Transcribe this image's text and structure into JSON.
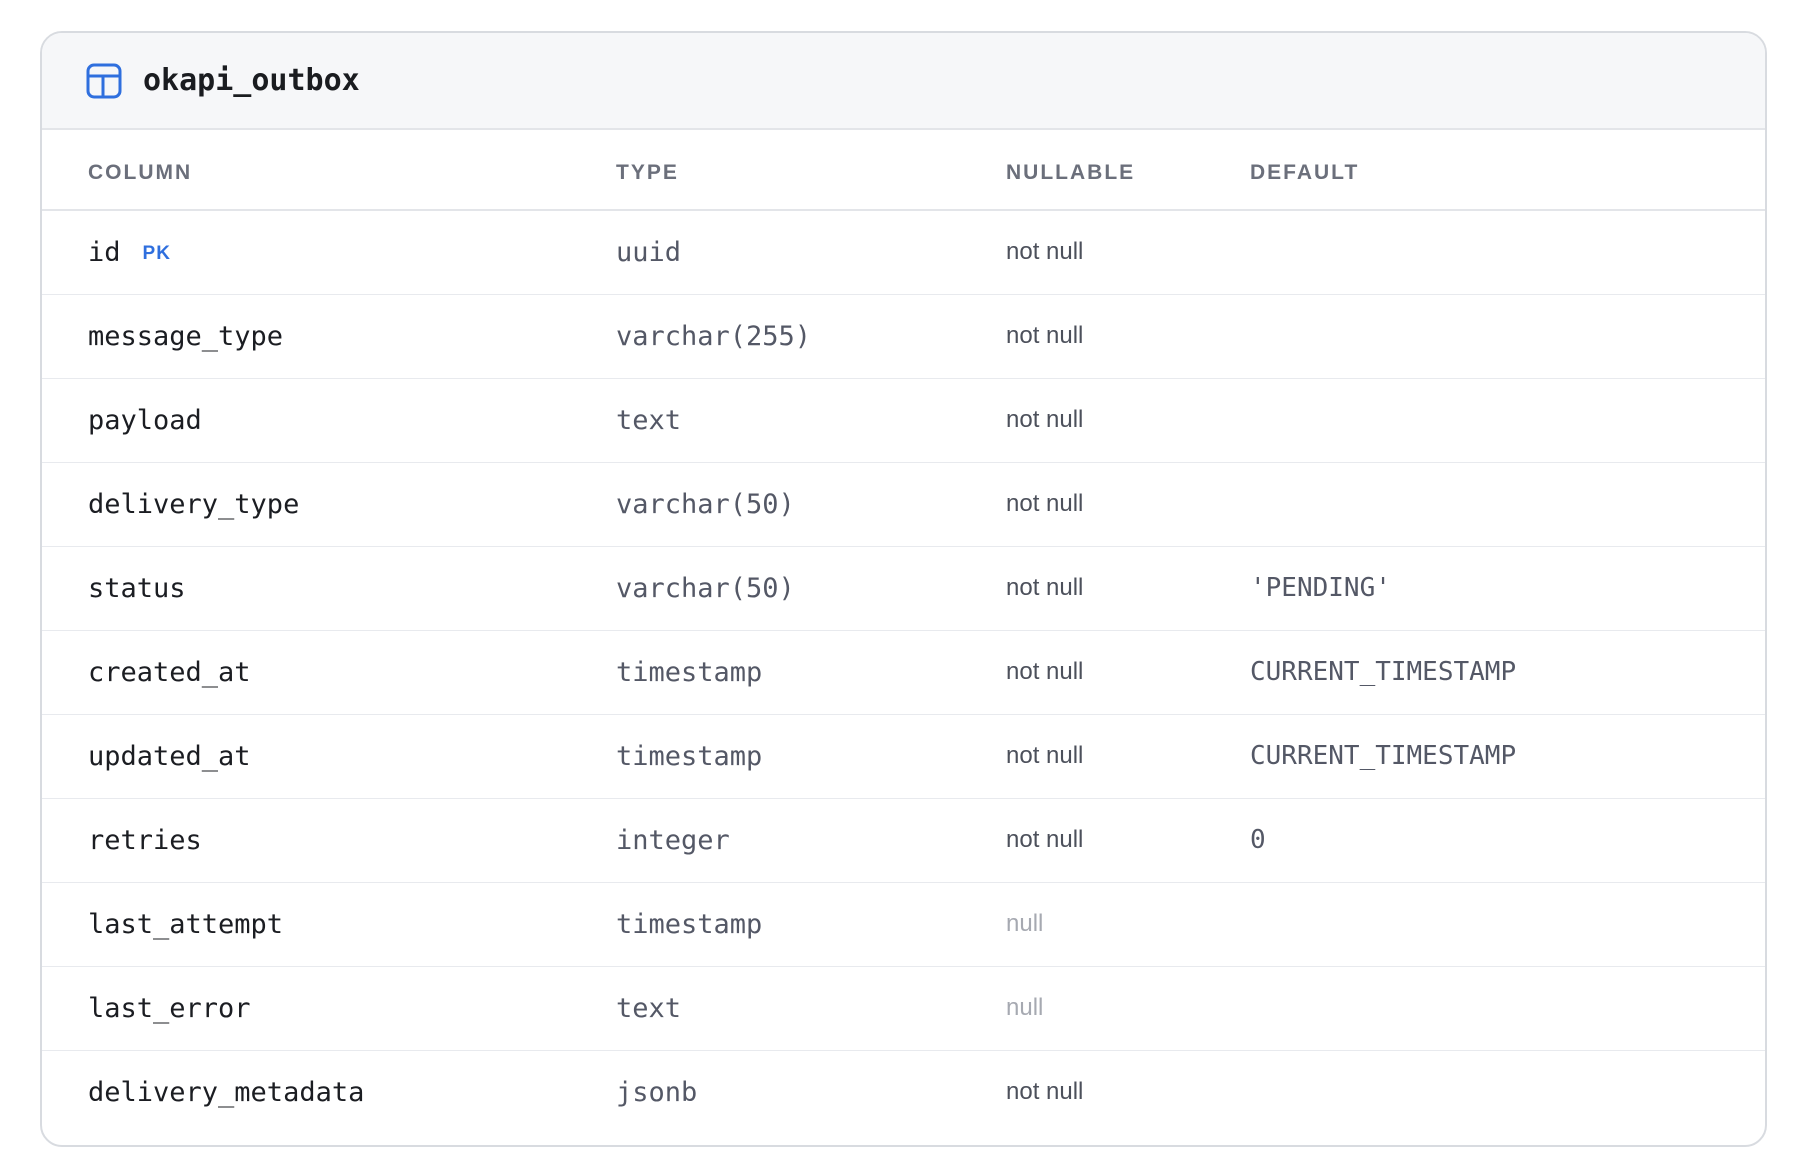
{
  "table": {
    "name": "okapi_outbox",
    "icon": "table-icon",
    "accent_color": "#2f6fde",
    "headers": {
      "column": "COLUMN",
      "type": "TYPE",
      "nullable": "NULLABLE",
      "default": "DEFAULT"
    },
    "rows": [
      {
        "name": "id",
        "badge": "PK",
        "type": "uuid",
        "nullable": "not null",
        "default": ""
      },
      {
        "name": "message_type",
        "badge": "",
        "type": "varchar(255)",
        "nullable": "not null",
        "default": ""
      },
      {
        "name": "payload",
        "badge": "",
        "type": "text",
        "nullable": "not null",
        "default": ""
      },
      {
        "name": "delivery_type",
        "badge": "",
        "type": "varchar(50)",
        "nullable": "not null",
        "default": ""
      },
      {
        "name": "status",
        "badge": "",
        "type": "varchar(50)",
        "nullable": "not null",
        "default": "'PENDING'"
      },
      {
        "name": "created_at",
        "badge": "",
        "type": "timestamp",
        "nullable": "not null",
        "default": "CURRENT_TIMESTAMP"
      },
      {
        "name": "updated_at",
        "badge": "",
        "type": "timestamp",
        "nullable": "not null",
        "default": "CURRENT_TIMESTAMP"
      },
      {
        "name": "retries",
        "badge": "",
        "type": "integer",
        "nullable": "not null",
        "default": "0"
      },
      {
        "name": "last_attempt",
        "badge": "",
        "type": "timestamp",
        "nullable": "null",
        "default": ""
      },
      {
        "name": "last_error",
        "badge": "",
        "type": "text",
        "nullable": "null",
        "default": ""
      },
      {
        "name": "delivery_metadata",
        "badge": "",
        "type": "jsonb",
        "nullable": "not null",
        "default": ""
      }
    ]
  }
}
